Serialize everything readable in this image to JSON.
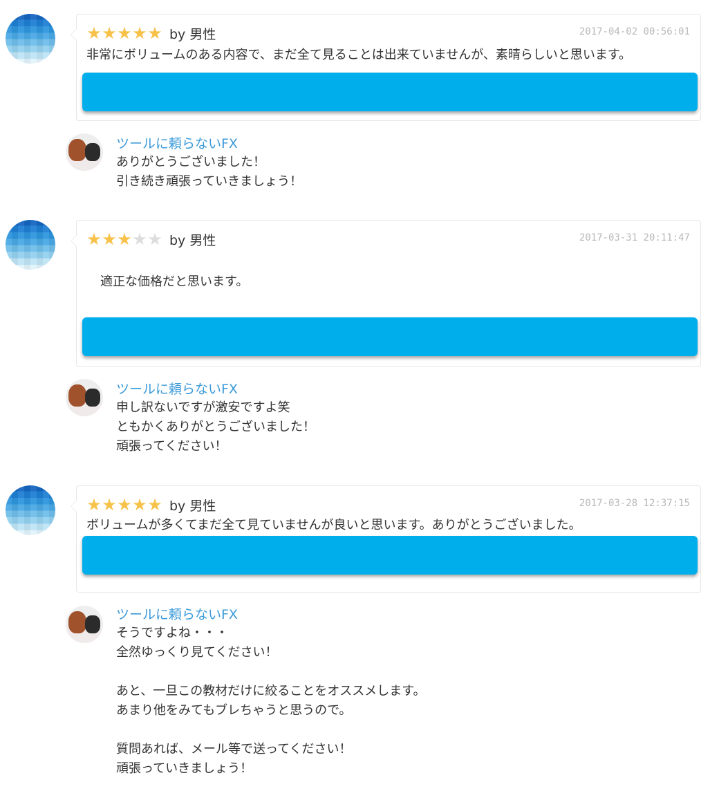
{
  "reviews": [
    {
      "stars_filled": 5,
      "stars_total": 5,
      "by": "by 男性",
      "date": "2017-04-02 00:56:01",
      "text": "非常にボリュームのある内容で、まだ全て見ることは出来ていませんが、素晴らしいと思います。",
      "reply": {
        "name": "ツールに頼らないFX",
        "text": "ありがとうございました！\n引き続き頑張っていきましょう！"
      }
    },
    {
      "stars_filled": 3,
      "stars_total": 5,
      "by": "by 男性",
      "date": "2017-03-31 20:11:47",
      "text": "適正な価格だと思います。",
      "reply": {
        "name": "ツールに頼らないFX",
        "text": "申し訳ないですが激安ですよ笑\nともかくありがとうございました！\n頑張ってください！"
      }
    },
    {
      "stars_filled": 5,
      "stars_total": 5,
      "by": "by 男性",
      "date": "2017-03-28 12:37:15",
      "text": "ボリュームが多くてまだ全て見ていませんが良いと思います。ありがとうございました。",
      "reply": {
        "name": "ツールに頼らないFX",
        "text": "そうですよね・・・\n全然ゆっくり見てください！\n\nあと、一旦この教材だけに絞ることをオススメします。\nあまり他をみてもブレちゃうと思うので。\n\n質問あれば、メール等で送ってください！\n頑張っていきましょう！"
      }
    }
  ],
  "colors": {
    "star_on": "#f7c24a",
    "star_off": "#dddddd",
    "bar": "#00aeec",
    "reply_name": "#3b9ad9",
    "date": "#b8b8b8"
  },
  "icons": {
    "star": "star-icon",
    "reviewer_avatar": "reviewer-avatar",
    "reply_avatar": "shop-avatar"
  }
}
